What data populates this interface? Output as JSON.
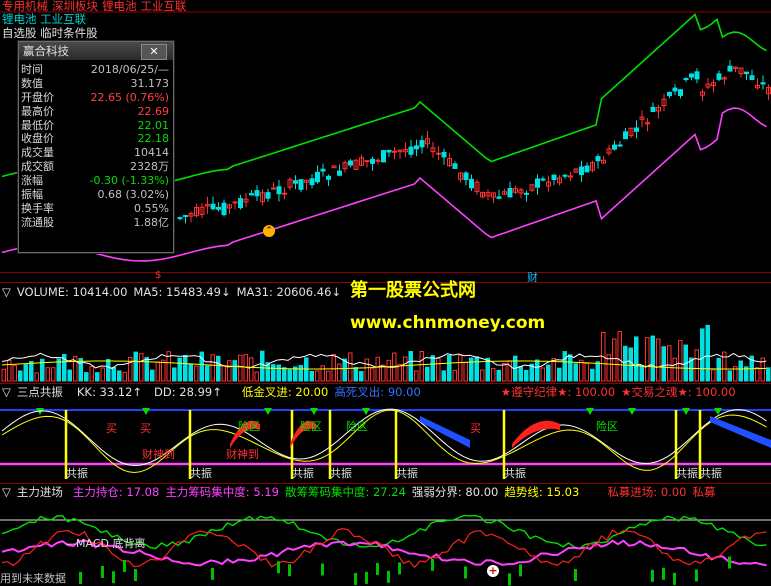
{
  "top": {
    "line1": [
      "专用机械",
      "深圳板块",
      "锂电池",
      "工业互联"
    ],
    "line2": "锂电池 工业互联",
    "line3": "自选股 临时条件股"
  },
  "info": {
    "title": "赢合科技",
    "close": "✕",
    "rows": [
      {
        "k": "时间",
        "v": "2018/06/25/—",
        "c": "#c0c0c0"
      },
      {
        "k": "数值",
        "v": "31.173",
        "c": "#c0c0c0"
      },
      {
        "k": "开盘价",
        "v": "22.65 (0.76%)",
        "c": "#ff4040"
      },
      {
        "k": "最高价",
        "v": "22.69",
        "c": "#ff4040"
      },
      {
        "k": "最低价",
        "v": "22.01",
        "c": "#00e000"
      },
      {
        "k": "收盘价",
        "v": "22.18",
        "c": "#00e000"
      },
      {
        "k": "成交量",
        "v": "10414",
        "c": "#c0c0c0"
      },
      {
        "k": "成交额",
        "v": "2328万",
        "c": "#c0c0c0"
      },
      {
        "k": "涨幅",
        "v": "-0.30 (-1.33%)",
        "c": "#00e000"
      },
      {
        "k": "振幅",
        "v": "0.68 (3.02%)",
        "c": "#c0c0c0"
      },
      {
        "k": "换手率",
        "v": "0.55%",
        "c": "#c0c0c0"
      },
      {
        "k": "流通股",
        "v": "1.88亿",
        "c": "#c0c0c0"
      }
    ]
  },
  "marks": {
    "dollar": "$",
    "cai": "财"
  },
  "watermark": {
    "name": "第一股票公式网",
    "url": "www.chnmoney.com"
  },
  "volume": {
    "label": "VOLUME: 10414.00",
    "ma5": "MA5: 15483.49",
    "ma31": "MA31: 20606.46",
    "arrow": "↓"
  },
  "sandian": {
    "name": "三点共振",
    "kk": "KK: 33.12",
    "dd": "DD: 28.99",
    "arrow": "↑",
    "low_gold": "低金叉进: 20.00",
    "high_dead": "高死叉出: 90.00",
    "keep_rule": "★遵守纪律★: 100.00",
    "trade_soul": "★交易之魂★: 100.00",
    "gongzhen": "共振",
    "caishen": "财神到",
    "danger": "险区",
    "buy": "买"
  },
  "zhuli": {
    "name": "主力进场",
    "hold": "主力持仓: 17.08",
    "chip": "主力筹码集中度: 5.19",
    "scatter": "散筹筹码集中度: 27.24",
    "strength": "强弱分界: 80.00",
    "trend": "趋势线: 15.03",
    "private": "私募进场: 0.00",
    "private2": "私募",
    "macd": "MACD 底背离",
    "future": "用到未来数据"
  }
}
